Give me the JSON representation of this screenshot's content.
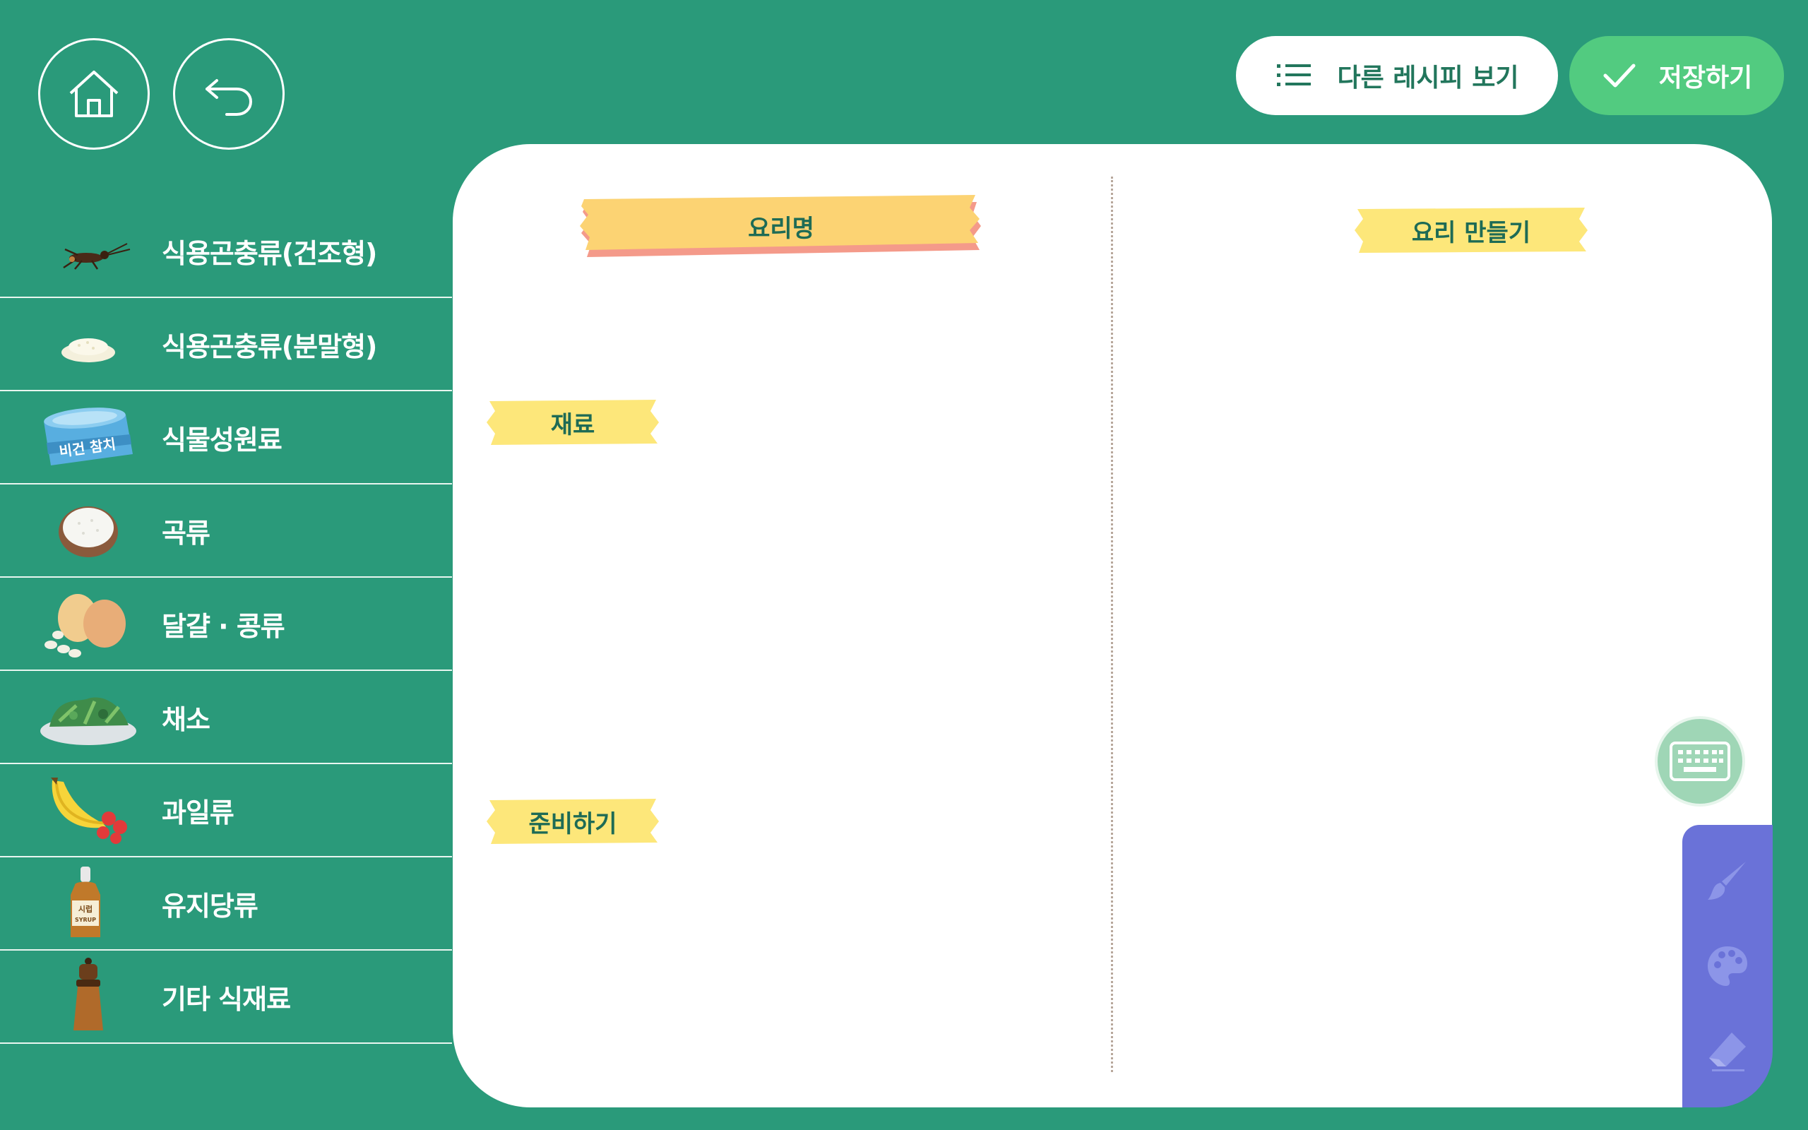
{
  "header": {
    "home_icon": "home-icon",
    "back_icon": "undo-arrow-icon",
    "recipes_button": "다른 레시피 보기",
    "save_button": "저장하기"
  },
  "sidebar": {
    "items": [
      {
        "label": "식용곤충류(건조형)",
        "icon": "cricket-icon"
      },
      {
        "label": "식용곤충류(분말형)",
        "icon": "powder-icon"
      },
      {
        "label": "식물성원료",
        "icon": "vegan-tuna-can-icon",
        "icon_text": "비건 참치"
      },
      {
        "label": "곡류",
        "icon": "rice-bowl-icon"
      },
      {
        "label": "달걀 · 콩류",
        "icon": "egg-beans-icon"
      },
      {
        "label": "채소",
        "icon": "salad-plate-icon"
      },
      {
        "label": "과일류",
        "icon": "banana-strawberry-icon"
      },
      {
        "label": "유지당류",
        "icon": "syrup-bottle-icon",
        "icon_text": "시럽 SYRUP"
      },
      {
        "label": "기타 식재료",
        "icon": "pepper-grinder-icon"
      }
    ]
  },
  "card": {
    "dish_name_label": "요리명",
    "make_label": "요리 만들기",
    "ingredients_label": "재료",
    "prep_label": "준비하기"
  },
  "tools": {
    "keyboard": "keyboard-icon",
    "brush": "brush-icon",
    "palette": "palette-icon",
    "eraser": "eraser-icon"
  },
  "colors": {
    "background": "#2a9a7a",
    "card": "#ffffff",
    "save_button": "#52cb80",
    "tape_yellow": "#fde77a",
    "tape_orange": "#fcd373",
    "tools_panel": "#6a72d8"
  }
}
